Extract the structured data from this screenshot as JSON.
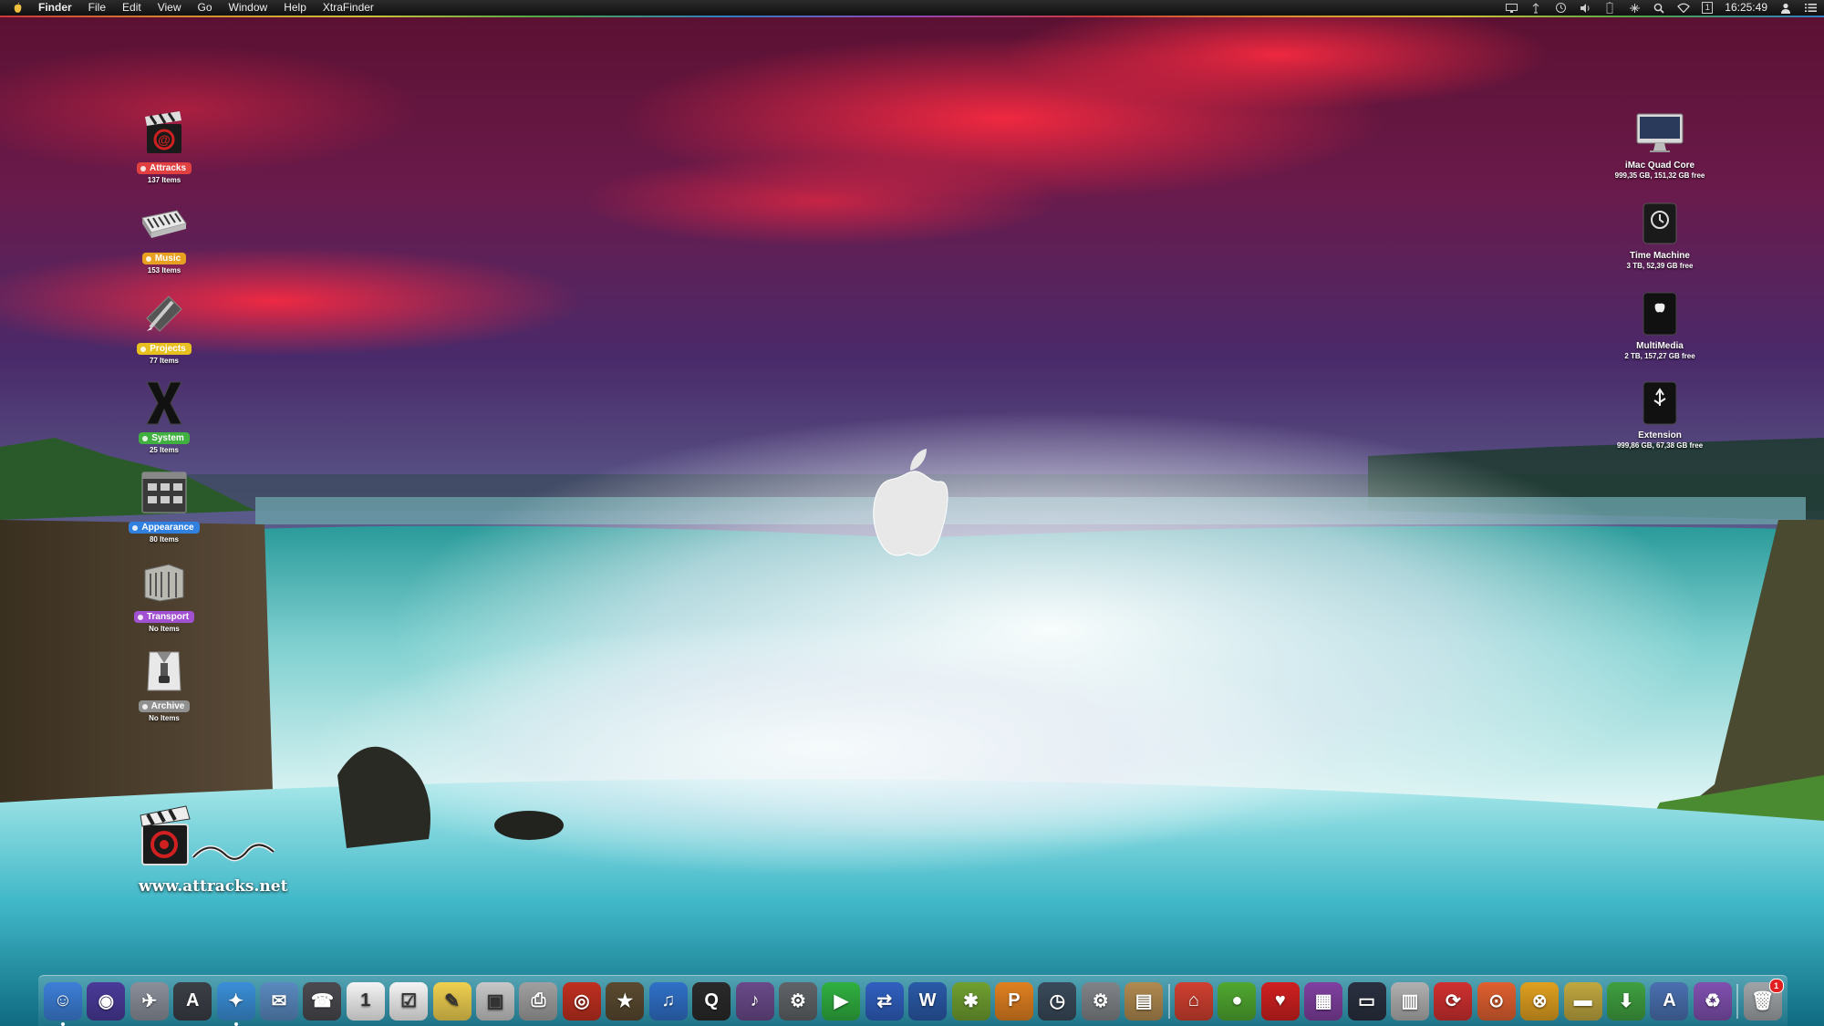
{
  "menubar": {
    "app": "Finder",
    "menus": [
      "File",
      "Edit",
      "View",
      "Go",
      "Window",
      "Help",
      "XtraFinder"
    ],
    "status_icons": [
      "display-icon",
      "airdrop-icon",
      "time-machine-icon",
      "volume-icon",
      "battery-icon",
      "network-icon",
      "spotlight-icon",
      "wifi-icon",
      "screen-number-icon"
    ],
    "screen_number": "1",
    "clock": "16:25:49"
  },
  "desktop_left": [
    {
      "label": "Attracks",
      "count": "137 Items",
      "color": "#e04040",
      "icon": "clapperboard-icon"
    },
    {
      "label": "Music",
      "count": "153 Items",
      "color": "#e8a020",
      "icon": "keyboard-icon"
    },
    {
      "label": "Projects",
      "count": "77 Items",
      "color": "#e8c020",
      "icon": "pencil-icon"
    },
    {
      "label": "System",
      "count": "25 Items",
      "color": "#40b040",
      "icon": "x-icon"
    },
    {
      "label": "Appearance",
      "count": "80 Items",
      "color": "#3080e0",
      "icon": "finder-window-icon"
    },
    {
      "label": "Transport",
      "count": "No Items",
      "color": "#a050d0",
      "icon": "building-icon"
    },
    {
      "label": "Archive",
      "count": "No Items",
      "color": "#909090",
      "icon": "archive-icon"
    }
  ],
  "desktop_right": [
    {
      "name": "iMac Quad Core",
      "info": "999,35 GB, 151,32 GB free",
      "icon": "imac-icon"
    },
    {
      "name": "Time Machine",
      "info": "3 TB, 52,39 GB free",
      "icon": "time-machine-drive-icon"
    },
    {
      "name": "MultiMedia",
      "info": "2 TB, 157,27 GB free",
      "icon": "external-drive-icon"
    },
    {
      "name": "Extension",
      "info": "999,86 GB, 67,38 GB free",
      "icon": "usb-drive-icon"
    }
  ],
  "logo": {
    "url": "www.attracks.net"
  },
  "dock": [
    {
      "icon": "finder-icon",
      "bg": "#3d7fd8",
      "glyph": "☺",
      "running": true
    },
    {
      "icon": "siri-icon",
      "bg": "#4a3a9a",
      "glyph": "◉",
      "running": false
    },
    {
      "icon": "launchpad-icon",
      "bg": "#8a8f9a",
      "glyph": "✈",
      "running": false
    },
    {
      "icon": "app-store-icon",
      "bg": "#3b3f46",
      "glyph": "A",
      "running": false
    },
    {
      "icon": "safari-icon",
      "bg": "#3a8fd8",
      "glyph": "✦",
      "running": true
    },
    {
      "icon": "mail-icon",
      "bg": "#5a8ac0",
      "glyph": "✉",
      "running": false
    },
    {
      "icon": "contacts-icon",
      "bg": "#4a4a50",
      "glyph": "☎",
      "running": false
    },
    {
      "icon": "calendar-icon",
      "bg": "#f4f4f4",
      "glyph": "1",
      "running": false
    },
    {
      "icon": "reminders-icon",
      "bg": "#f4f4f4",
      "glyph": "☑",
      "running": false
    },
    {
      "icon": "notes-icon",
      "bg": "#f0d050",
      "glyph": "✎",
      "running": false
    },
    {
      "icon": "preview-icon",
      "bg": "#c8c8c8",
      "glyph": "▣",
      "running": false
    },
    {
      "icon": "printer-icon",
      "bg": "#a0a0a0",
      "glyph": "⎙",
      "running": false
    },
    {
      "icon": "photo-booth-icon",
      "bg": "#c03020",
      "glyph": "◎",
      "running": false
    },
    {
      "icon": "imovie-icon",
      "bg": "#5a4a30",
      "glyph": "★",
      "running": false
    },
    {
      "icon": "itunes-icon",
      "bg": "#3070c8",
      "glyph": "♫",
      "running": false
    },
    {
      "icon": "quicktime-icon",
      "bg": "#2a2a2a",
      "glyph": "Q",
      "running": false
    },
    {
      "icon": "music-icon",
      "bg": "#6a4a8a",
      "glyph": "♪",
      "running": false
    },
    {
      "icon": "utility-icon",
      "bg": "#606468",
      "glyph": "⚙",
      "running": false
    },
    {
      "icon": "facetime-icon",
      "bg": "#30b040",
      "glyph": "▶",
      "running": false
    },
    {
      "icon": "migration-icon",
      "bg": "#3060c0",
      "glyph": "⇄",
      "running": false
    },
    {
      "icon": "word-icon",
      "bg": "#2a5aa8",
      "glyph": "W",
      "running": false
    },
    {
      "icon": "network-icon",
      "bg": "#70a030",
      "glyph": "✱",
      "running": false
    },
    {
      "icon": "pages-icon",
      "bg": "#e08020",
      "glyph": "P",
      "running": false
    },
    {
      "icon": "time-machine-icon",
      "bg": "#3a4a5a",
      "glyph": "◷",
      "running": false
    },
    {
      "icon": "system-preferences-icon",
      "bg": "#808488",
      "glyph": "⚙",
      "running": false
    },
    {
      "icon": "archive-utility-icon",
      "bg": "#b08a50",
      "glyph": "▤",
      "running": false
    },
    {
      "icon": "home-icon",
      "bg": "#d04030",
      "glyph": "⌂",
      "running": false
    },
    {
      "icon": "apple-icon",
      "bg": "#50a830",
      "glyph": "●",
      "running": false
    },
    {
      "icon": "heart-icon",
      "bg": "#d02020",
      "glyph": "♥",
      "running": false
    },
    {
      "icon": "cube-icon",
      "bg": "#8040a0",
      "glyph": "▦",
      "running": false
    },
    {
      "icon": "monitor-icon",
      "bg": "#2a3040",
      "glyph": "▭",
      "running": false
    },
    {
      "icon": "computer-icon",
      "bg": "#b0b0b0",
      "glyph": "▥",
      "running": false
    },
    {
      "icon": "backup-icon",
      "bg": "#d03030",
      "glyph": "⟳",
      "running": false
    },
    {
      "icon": "downloads-folder-icon",
      "bg": "#e06030",
      "glyph": "⊙",
      "running": false
    },
    {
      "icon": "sync-icon",
      "bg": "#e0a020",
      "glyph": "⊗",
      "running": false
    },
    {
      "icon": "folder-icon",
      "bg": "#c0a840",
      "glyph": "▬",
      "running": false
    },
    {
      "icon": "download-icon",
      "bg": "#40a040",
      "glyph": "⬇",
      "running": false
    },
    {
      "icon": "applications-folder-icon",
      "bg": "#4a70b0",
      "glyph": "A",
      "running": false
    },
    {
      "icon": "recycle-icon",
      "bg": "#8050b0",
      "glyph": "♻",
      "running": false
    },
    {
      "icon": "trash-icon",
      "bg": "#a0a4a8",
      "glyph": "🗑",
      "running": false,
      "badge": "1"
    }
  ]
}
